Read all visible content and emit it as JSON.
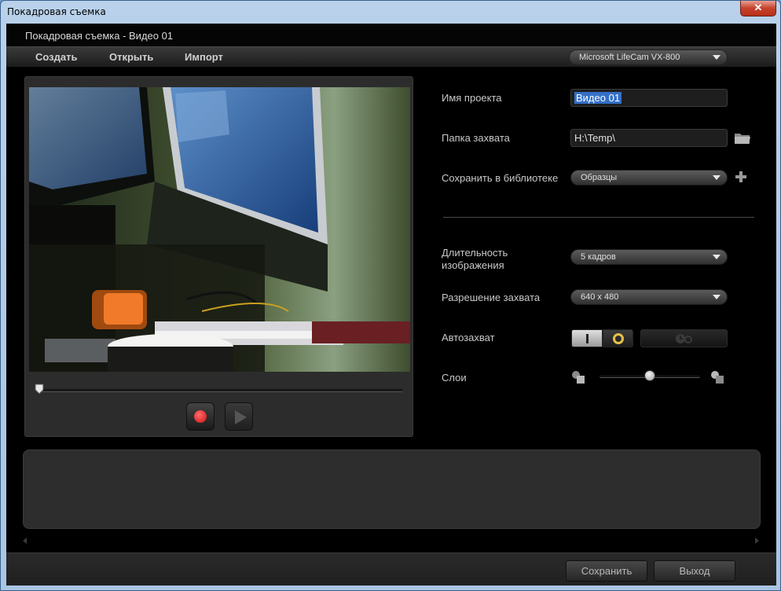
{
  "window": {
    "title": "Покадровая съемка",
    "close_glyph": "✕"
  },
  "document": {
    "title": "Покадровая съемка - Видео 01"
  },
  "menu": {
    "items": [
      {
        "label": "Создать"
      },
      {
        "label": "Открыть"
      },
      {
        "label": "Импорт"
      }
    ]
  },
  "camera": {
    "selected": "Microsoft LifeCam VX-800"
  },
  "form": {
    "project_name": {
      "label": "Имя проекта",
      "value": "Видео 01"
    },
    "capture_folder": {
      "label": "Папка захвата",
      "value": "H:\\Temp\\"
    },
    "save_library": {
      "label": "Сохранить в библиотеке",
      "value": "Образцы"
    },
    "duration": {
      "label_line1": "Длительность",
      "label_line2": "изображения",
      "value": "5 кадров"
    },
    "resolution": {
      "label": "Разрешение захвата",
      "value": "640 x 480"
    },
    "autocapture": {
      "label": "Автозахват"
    },
    "layers": {
      "label": "Слои",
      "level": 0.5
    }
  },
  "footer": {
    "save_label": "Сохранить",
    "exit_label": "Выход"
  },
  "colors": {
    "accent_record": "#d01010",
    "toggle_ring": "#e8c14a",
    "selection": "#3470c8"
  }
}
